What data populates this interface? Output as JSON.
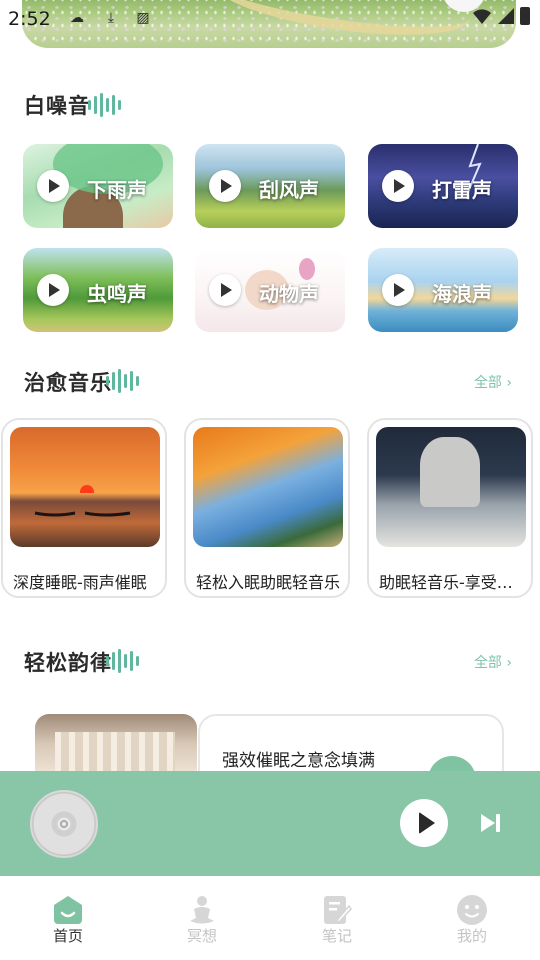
{
  "status_bar": {
    "time": "2:52"
  },
  "white_noise": {
    "title": "白噪音",
    "items": [
      {
        "label": "下雨声"
      },
      {
        "label": "刮风声"
      },
      {
        "label": "打雷声"
      },
      {
        "label": "虫鸣声"
      },
      {
        "label": "动物声"
      },
      {
        "label": "海浪声"
      }
    ]
  },
  "healing_music": {
    "title": "治愈音乐",
    "more_label": "全部 ›",
    "items": [
      {
        "title": "深度睡眠-雨声催眠"
      },
      {
        "title": "轻松入眠助眠轻音乐"
      },
      {
        "title": "助眠轻音乐-享受安静"
      }
    ]
  },
  "relax_rhythm": {
    "title": "轻松韵律",
    "more_label": "全部 ›",
    "item_title": "强效催眠之意念填满"
  },
  "player": {
    "state": "paused"
  },
  "tabs": [
    {
      "label": "首页",
      "icon": "home-icon",
      "active": true
    },
    {
      "label": "冥想",
      "icon": "meditation-icon",
      "active": false
    },
    {
      "label": "笔记",
      "icon": "notes-icon",
      "active": false
    },
    {
      "label": "我的",
      "icon": "profile-icon",
      "active": false
    }
  ],
  "colors": {
    "accent": "#5fb79d",
    "player_bg": "#89c6a7",
    "more_link": "#7fc3ac"
  }
}
